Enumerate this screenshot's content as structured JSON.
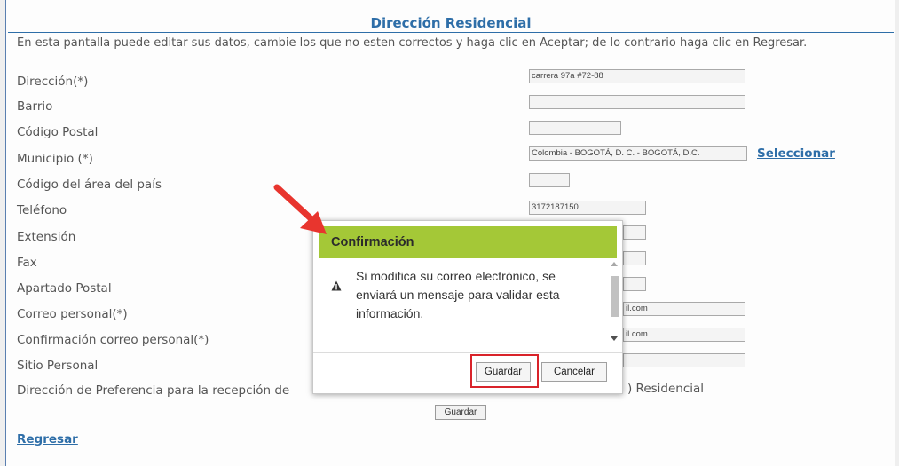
{
  "page": {
    "title": "Dirección Residencial",
    "intro": "En esta pantalla puede editar sus datos, cambie los que no esten correctos y haga clic en Aceptar; de lo contrario haga clic en Regresar."
  },
  "form": {
    "direccion": {
      "label": "Dirección(*)",
      "value": "carrera 97a #72-88"
    },
    "barrio": {
      "label": "Barrio",
      "value": ""
    },
    "codigo_postal": {
      "label": "Código Postal",
      "value": ""
    },
    "municipio": {
      "label": "Municipio (*)",
      "value": "Colombia - BOGOTÁ, D. C. - BOGOTÁ, D.C.",
      "link": "Seleccionar"
    },
    "codigo_area": {
      "label": "Código del área del país",
      "value": ""
    },
    "telefono": {
      "label": "Teléfono",
      "value": "3172187150"
    },
    "extension": {
      "label": "Extensión",
      "value": ""
    },
    "fax": {
      "label": "Fax",
      "value": ""
    },
    "apartado": {
      "label": "Apartado Postal",
      "value": ""
    },
    "correo": {
      "label": "Correo personal(*)",
      "value_fragment": "il.com"
    },
    "confirm_correo": {
      "label": "Confirmación correo personal(*)",
      "value_fragment": "il.com"
    },
    "sitio": {
      "label": "Sitio Personal",
      "value": ""
    },
    "preferencia": {
      "label_fragment": "Dirección de Preferencia para la recepción de",
      "option_fragment": ") Residencial"
    }
  },
  "actions": {
    "guardar": "Guardar",
    "regresar": "Regresar"
  },
  "dialog": {
    "title": "Confirmación",
    "message_lines": [
      "Si modifica su correo electrónico, se",
      "enviará un mensaje para validar esta",
      "información."
    ],
    "icon": "warning-icon",
    "guardar": "Guardar",
    "cancelar": "Cancelar"
  },
  "colors": {
    "dialog_header": "#a4c837",
    "highlight": "#d9232a",
    "arrow": "#e8352e",
    "link": "#2e6ea8"
  }
}
